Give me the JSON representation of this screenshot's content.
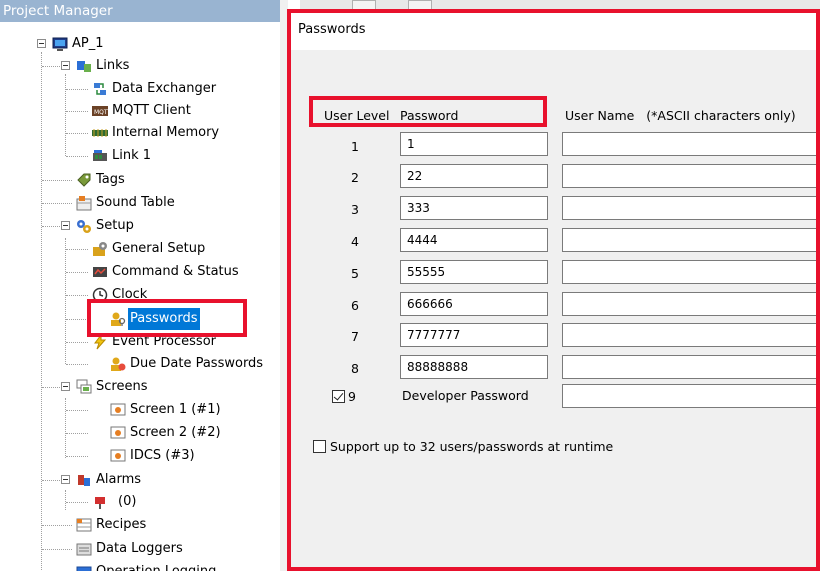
{
  "project_manager": {
    "title": "Project Manager",
    "tree": {
      "root": "AP_1",
      "links": "Links",
      "data_exchanger": "Data Exchanger",
      "mqtt_client": "MQTT Client",
      "internal_memory": "Internal Memory",
      "link1": "Link 1",
      "tags": "Tags",
      "sound_table": "Sound Table",
      "setup": "Setup",
      "general_setup": "General Setup",
      "command_status": "Command & Status",
      "clock": "Clock",
      "passwords": "Passwords",
      "event_processor": "Event Processor",
      "due_date_passwords": "Due Date Passwords",
      "screens": "Screens",
      "screen1": "Screen 1 (#1)",
      "screen2": "Screen 2 (#2)",
      "idcs": "IDCS (#3)",
      "alarms": "Alarms",
      "alarm0": "(0)",
      "recipes": "Recipes",
      "data_loggers": "Data Loggers",
      "operation_logging": "Operation Logging"
    }
  },
  "passwords_panel": {
    "title": "Passwords",
    "headers": {
      "user_level": "User Level",
      "password": "Password",
      "user_name": "User Name   (*ASCII characters only)"
    },
    "rows": [
      {
        "level": "1",
        "password": "1"
      },
      {
        "level": "2",
        "password": "22"
      },
      {
        "level": "3",
        "password": "333"
      },
      {
        "level": "4",
        "password": "4444"
      },
      {
        "level": "5",
        "password": "55555"
      },
      {
        "level": "6",
        "password": "666666"
      },
      {
        "level": "7",
        "password": "7777777"
      },
      {
        "level": "8",
        "password": "88888888"
      }
    ],
    "developer_row": {
      "level": "9",
      "label": "Developer Password",
      "checked": true
    },
    "support_32_label": "Support up to 32 users/passwords at runtime",
    "support_32_checked": false
  },
  "colors": {
    "highlight_red": "#e8112d",
    "selection_blue": "#0078d7",
    "title_bar": "#99b4d1"
  }
}
